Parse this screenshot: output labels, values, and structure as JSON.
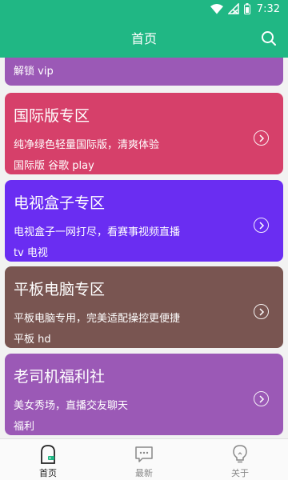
{
  "status_bar": {
    "time": "7:32"
  },
  "header": {
    "title": "首页"
  },
  "cards": [
    {
      "title": "",
      "desc": "",
      "tags": "解锁 vip",
      "color": "#9b59b6"
    },
    {
      "title": "国际版专区",
      "desc": "纯净绿色轻量国际版，清爽体验",
      "tags": "国际版 谷歌 play",
      "color": "#d6406a"
    },
    {
      "title": "电视盒子专区",
      "desc": "电视盒子一网打尽，看赛事视频直播",
      "tags": "tv 电视",
      "color": "#6a2df2"
    },
    {
      "title": "平板电脑专区",
      "desc": "平板电脑专用，完美适配操控更便捷",
      "tags": "平板 hd",
      "color": "#795551"
    },
    {
      "title": "老司机福利社",
      "desc": "美女秀场，直播交友聊天",
      "tags": "福利",
      "color": "#9b59b6"
    }
  ],
  "nav": [
    {
      "label": "首页",
      "icon": "home-icon",
      "active": true
    },
    {
      "label": "最新",
      "icon": "chat-icon",
      "active": false
    },
    {
      "label": "关于",
      "icon": "lightbulb-icon",
      "active": false
    }
  ],
  "colors": {
    "header": "#20b784",
    "accent": "#20b784"
  }
}
